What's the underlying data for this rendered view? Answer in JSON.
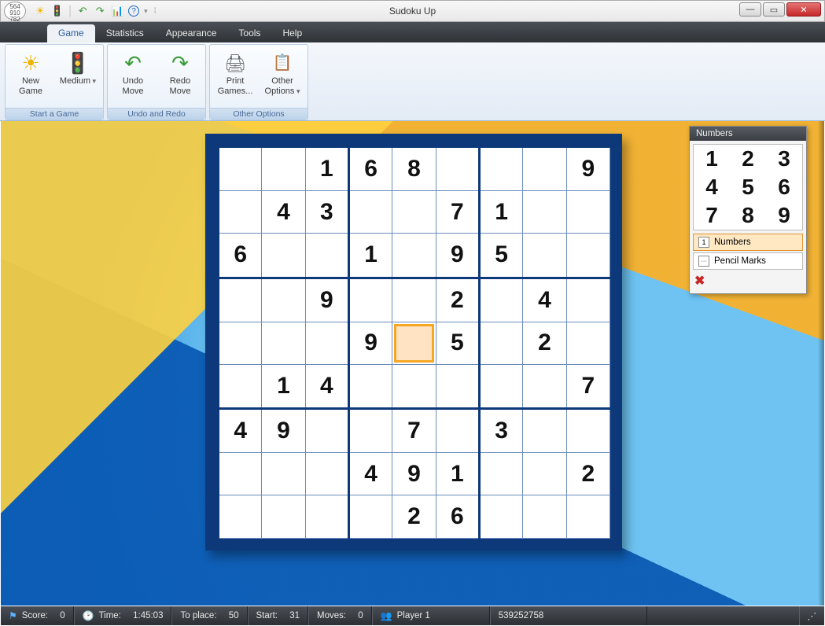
{
  "window": {
    "title": "Sudoku Up"
  },
  "qat": {
    "sun": "☀",
    "light": "🚦",
    "undo": "↶",
    "redo": "↷",
    "chart": "📊",
    "help": "?"
  },
  "tabs": {
    "game": "Game",
    "statistics": "Statistics",
    "appearance": "Appearance",
    "tools": "Tools",
    "help": "Help"
  },
  "ribbon": {
    "group_start": "Start a Game",
    "group_undo": "Undo and Redo",
    "group_other": "Other Options",
    "new_game_l1": "New",
    "new_game_l2": "Game",
    "difficulty": "Medium",
    "undo_l1": "Undo",
    "undo_l2": "Move",
    "redo_l1": "Redo",
    "redo_l2": "Move",
    "print_l1": "Print",
    "print_l2": "Games...",
    "other_l1": "Other",
    "other_l2": "Options"
  },
  "numpanel": {
    "title": "Numbers",
    "n1": "1",
    "n2": "2",
    "n3": "3",
    "n4": "4",
    "n5": "5",
    "n6": "6",
    "n7": "7",
    "n8": "8",
    "n9": "9",
    "mode_numbers": "Numbers",
    "mode_pencil": "Pencil Marks",
    "erase": "✖"
  },
  "status": {
    "score_label": "Score:",
    "score_val": "0",
    "time_label": "Time:",
    "time_val": "1:45:03",
    "toplace_label": "To place:",
    "toplace_val": "50",
    "start_label": "Start:",
    "start_val": "31",
    "moves_label": "Moves:",
    "moves_val": "0",
    "player_label": "Player 1",
    "puzzle_id": "539252758"
  },
  "sudoku": {
    "selected": [
      4,
      4
    ],
    "grid": [
      [
        "",
        "",
        "1",
        "6",
        "8",
        "",
        "",
        "",
        "9"
      ],
      [
        "",
        "4",
        "3",
        "",
        "",
        "7",
        "1",
        "",
        ""
      ],
      [
        "6",
        "",
        "",
        "1",
        "",
        "9",
        "5",
        "",
        ""
      ],
      [
        "",
        "",
        "9",
        "",
        "",
        "2",
        "",
        "4",
        ""
      ],
      [
        "",
        "",
        "",
        "9",
        "",
        "5",
        "",
        "2",
        ""
      ],
      [
        "",
        "1",
        "4",
        "",
        "",
        "",
        "",
        "",
        "7"
      ],
      [
        "4",
        "9",
        "",
        "",
        "7",
        "",
        "3",
        "",
        ""
      ],
      [
        "",
        "",
        "",
        "4",
        "9",
        "1",
        "",
        "",
        "2"
      ],
      [
        "",
        "",
        "",
        "",
        "2",
        "6",
        "",
        "",
        ""
      ]
    ]
  }
}
